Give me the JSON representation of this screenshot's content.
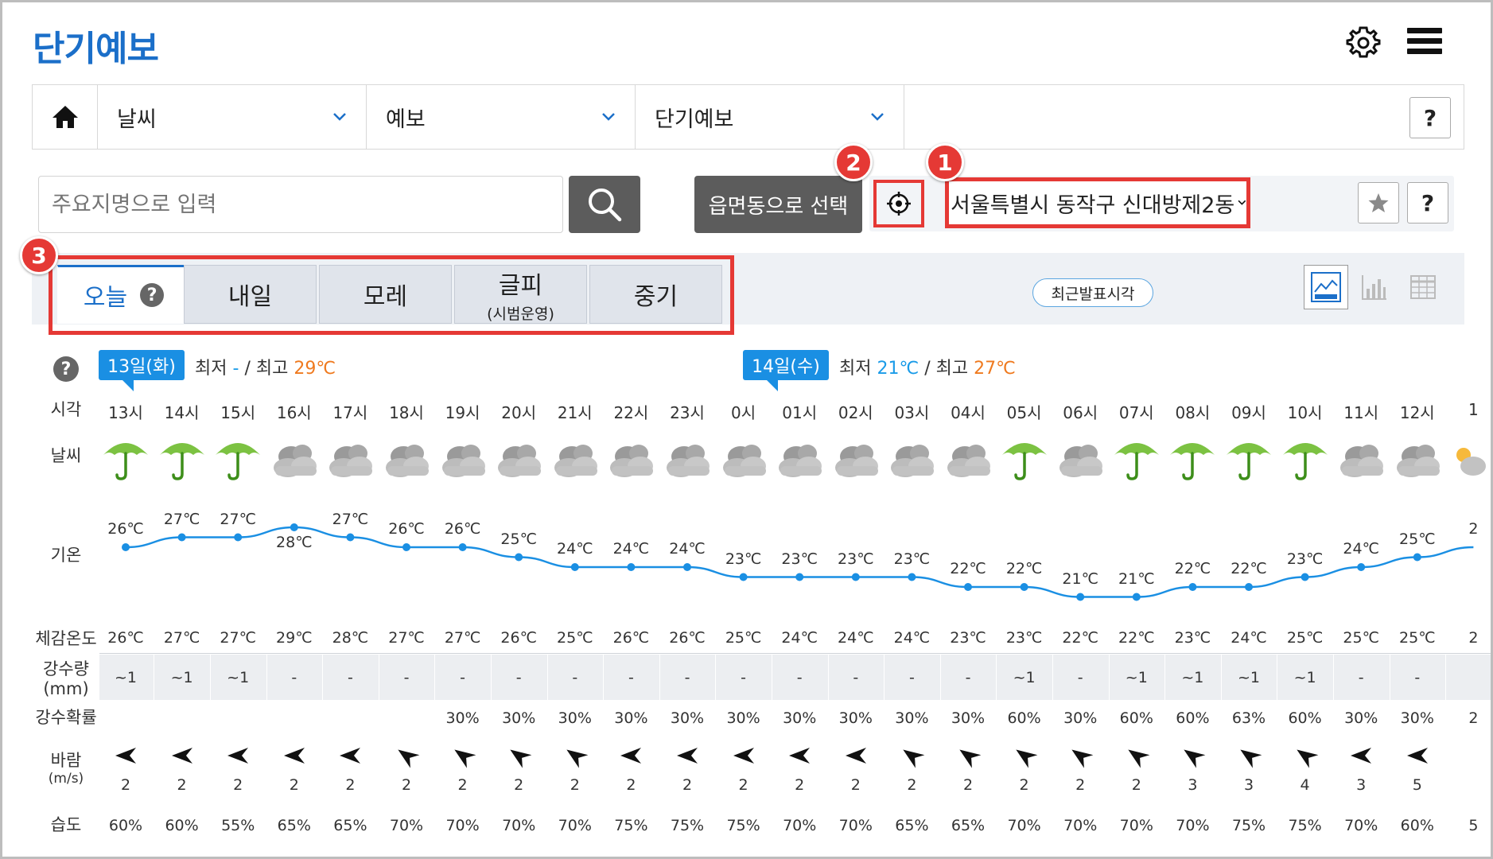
{
  "header": {
    "title": "단기예보"
  },
  "nav": {
    "items": [
      {
        "label": "날씨"
      },
      {
        "label": "예보"
      },
      {
        "label": "단기예보"
      }
    ],
    "help": "?"
  },
  "search": {
    "placeholder": "주요지명으로 입력",
    "dong_button": "읍면동으로 선택"
  },
  "location": {
    "selected": "서울특별시 동작구 신대방제2동",
    "help": "?"
  },
  "badges": [
    "1",
    "2",
    "3"
  ],
  "tabs": [
    {
      "label": "오늘"
    },
    {
      "label": "내일"
    },
    {
      "label": "모레"
    },
    {
      "label": "글피",
      "sub": "(시범운영)"
    },
    {
      "label": "중기"
    }
  ],
  "tab_help": "?",
  "recent_button": "최근발표시각",
  "help_icon": "?",
  "days": [
    {
      "label": "13일(화)",
      "min_label": "최저",
      "min": "-",
      "sep": "/",
      "max_label": "최고",
      "max": "29℃"
    },
    {
      "label": "14일(수)",
      "min_label": "최저",
      "min": "21℃",
      "sep": "/",
      "max_label": "최고",
      "max": "27℃"
    }
  ],
  "row_labels": {
    "time": "시각",
    "weather": "날씨",
    "temp": "기온",
    "feels": "체감온도",
    "precip": "강수량",
    "precip_unit": "(mm)",
    "prob": "강수확률",
    "wind": "바람",
    "wind_unit": "(m/s)",
    "humidity": "습도"
  },
  "colors": {
    "accent": "#1b6fc9",
    "line": "#1a8fe3",
    "highlight": "#e53935",
    "max": "#ef7a1f",
    "min": "#1a9be8"
  },
  "forecast": {
    "hours": [
      "13시",
      "14시",
      "15시",
      "16시",
      "17시",
      "18시",
      "19시",
      "20시",
      "21시",
      "22시",
      "23시",
      "0시",
      "01시",
      "02시",
      "03시",
      "04시",
      "05시",
      "06시",
      "07시",
      "08시",
      "09시",
      "10시",
      "11시",
      "12시",
      "1"
    ],
    "weather": [
      "rain",
      "rain",
      "rain",
      "cloudy",
      "cloudy",
      "cloudy",
      "cloudy",
      "cloudy",
      "cloudy",
      "cloudy",
      "cloudy",
      "cloudy",
      "cloudy",
      "cloudy",
      "cloudy",
      "cloudy",
      "rain",
      "cloudy",
      "rain",
      "rain",
      "rain",
      "rain",
      "cloudy",
      "cloudy",
      "partly-sunny"
    ],
    "temps": [
      26,
      27,
      27,
      28,
      27,
      26,
      26,
      25,
      24,
      24,
      24,
      23,
      23,
      23,
      23,
      22,
      22,
      21,
      21,
      22,
      22,
      23,
      24,
      25,
      26
    ],
    "temp_labels": [
      "26℃",
      "27℃",
      "27℃",
      "28℃",
      "27℃",
      "26℃",
      "26℃",
      "25℃",
      "24℃",
      "24℃",
      "24℃",
      "23℃",
      "23℃",
      "23℃",
      "23℃",
      "22℃",
      "22℃",
      "21℃",
      "21℃",
      "22℃",
      "22℃",
      "23℃",
      "24℃",
      "25℃",
      "2"
    ],
    "feels": [
      "26℃",
      "27℃",
      "27℃",
      "29℃",
      "28℃",
      "27℃",
      "27℃",
      "26℃",
      "25℃",
      "26℃",
      "26℃",
      "25℃",
      "24℃",
      "24℃",
      "24℃",
      "23℃",
      "23℃",
      "22℃",
      "22℃",
      "23℃",
      "24℃",
      "25℃",
      "25℃",
      "25℃",
      "2"
    ],
    "precip": [
      "~1",
      "~1",
      "~1",
      "-",
      "-",
      "-",
      "-",
      "-",
      "-",
      "-",
      "-",
      "-",
      "-",
      "-",
      "-",
      "-",
      "~1",
      "-",
      "~1",
      "~1",
      "~1",
      "~1",
      "-",
      "-",
      ""
    ],
    "prob": [
      "",
      "",
      "",
      "",
      "",
      "",
      "30%",
      "30%",
      "30%",
      "30%",
      "30%",
      "30%",
      "30%",
      "30%",
      "30%",
      "30%",
      "60%",
      "30%",
      "60%",
      "60%",
      "63%",
      "60%",
      "30%",
      "30%",
      "2"
    ],
    "wind_dir": [
      "E",
      "E",
      "E",
      "E",
      "E",
      "NE",
      "NE",
      "NE",
      "NE",
      "E",
      "E",
      "E",
      "E",
      "E",
      "NE",
      "NE",
      "NE",
      "NE",
      "NE",
      "NE",
      "NE",
      "NE",
      "E",
      "E",
      ""
    ],
    "wind_speed": [
      "2",
      "2",
      "2",
      "2",
      "2",
      "2",
      "2",
      "2",
      "2",
      "2",
      "2",
      "2",
      "2",
      "2",
      "2",
      "2",
      "2",
      "2",
      "2",
      "3",
      "3",
      "4",
      "3",
      "5",
      ""
    ],
    "humidity": [
      "60%",
      "60%",
      "55%",
      "65%",
      "65%",
      "70%",
      "70%",
      "70%",
      "70%",
      "75%",
      "75%",
      "75%",
      "70%",
      "70%",
      "65%",
      "65%",
      "70%",
      "70%",
      "70%",
      "70%",
      "75%",
      "75%",
      "70%",
      "60%",
      "5"
    ]
  }
}
